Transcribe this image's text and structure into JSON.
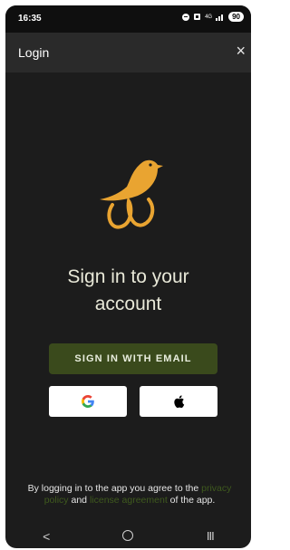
{
  "status_bar": {
    "time": "16:35",
    "network": "4G",
    "battery": "90"
  },
  "header": {
    "title": "Login",
    "close_icon": "×"
  },
  "main": {
    "heading_line1": "Sign in to your",
    "heading_line2": "account",
    "email_button": "SIGN IN WITH EMAIL",
    "google_button_icon": "google-icon",
    "apple_button_icon": "apple-icon"
  },
  "legal": {
    "prefix": "By logging in to the app you agree to the",
    "privacy_link": "privacy policy",
    "and": "and",
    "license_link": "license agreement",
    "suffix": "of the app."
  },
  "nav": {
    "back": "<",
    "recents": "III"
  },
  "colors": {
    "background": "#1c1c1c",
    "appbar": "#2a2a2a",
    "accent": "#e9a431",
    "button": "#3a4a1c",
    "link": "#3f5a1e"
  }
}
